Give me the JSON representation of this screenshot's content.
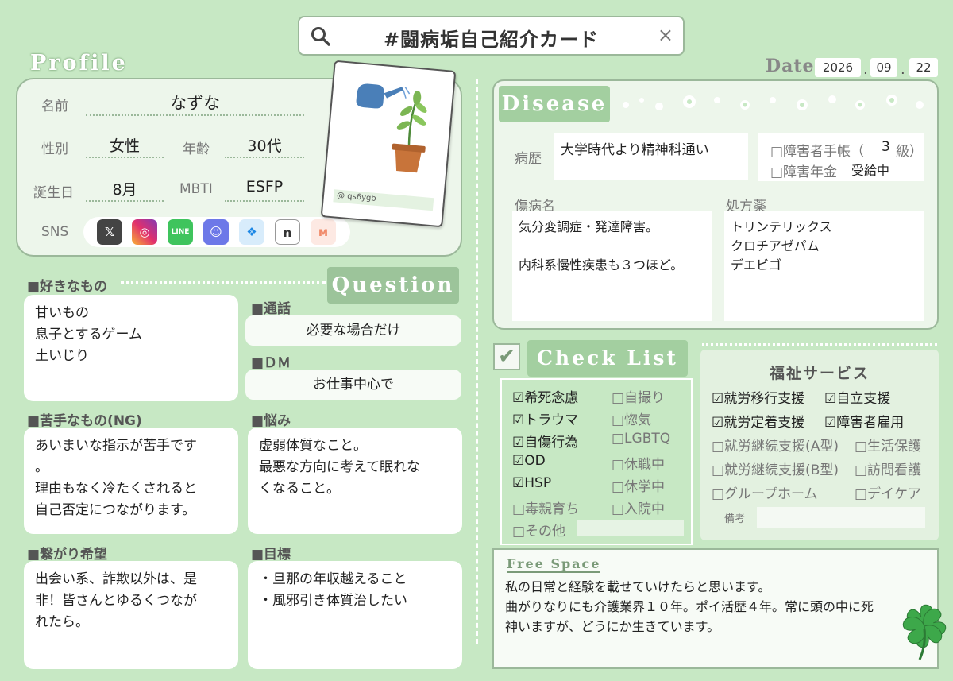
{
  "search": {
    "title": "#闘病垢自己紹介カード",
    "close": "×"
  },
  "profile": {
    "heading": "Profile",
    "name_label": "名前",
    "name": "なずな",
    "gender_label": "性別",
    "gender": "女性",
    "age_label": "年齢",
    "age": "30代",
    "birthday_label": "誕生日",
    "birthday": "8月",
    "mbti_label": "MBTI",
    "mbti": "ESFP",
    "sns_label": "SNS",
    "sns_icons": [
      "x-icon",
      "instagram-icon",
      "line-icon",
      "discord-icon",
      "bluesky-icon",
      "note-icon",
      "misskey-icon"
    ],
    "handle": "@ qs6ygb"
  },
  "date": {
    "label": "Date",
    "year": "2026",
    "month": "09",
    "day": "22",
    "sep": "."
  },
  "likes": {
    "title": "■好きなもの",
    "text": "甘いもの\n息子とするゲーム\n土いじり"
  },
  "question": {
    "title": "Question"
  },
  "call": {
    "title": "■通話",
    "value": "必要な場合だけ"
  },
  "dm": {
    "title": "■ＤＭ",
    "value": "お仕事中心で"
  },
  "dislikes": {
    "title": "■苦手なもの(NG)",
    "text": "あいまいな指示が苦手です\n。\n理由もなく冷たくされると\n自己否定につながります。"
  },
  "worries": {
    "title": "■悩み",
    "text": "虚弱体質なこと。\n最悪な方向に考えて眠れな\nくなること。"
  },
  "connect": {
    "title": "■繋がり希望",
    "text": "出会い系、詐欺以外は、是\n非！皆さんとゆるくつなが\nれたら。"
  },
  "goals": {
    "title": "■目標",
    "text": "・旦那の年収越えること\n・風邪引き体質治したい"
  },
  "disease": {
    "heading": "Disease",
    "history_label": "病歴",
    "history": "大学時代より精神科通い",
    "handbook": "□障害者手帳（",
    "grade": "3",
    "grade_suffix": "級）",
    "pension": "□障害年金",
    "pension_value": "受給中",
    "diagnosis_label": "傷病名",
    "diagnosis": "気分変調症・発達障害。\n\n内科系慢性疾患も３つほど。",
    "meds_label": "処方薬",
    "meds": "トリンテリックス\nクロチアゼパム\nデエビゴ"
  },
  "checklist": {
    "heading": "Check List",
    "left": [
      "☑希死念慮",
      "☑トラウマ",
      "☑自傷行為",
      "☑OD",
      "☑HSP",
      "□毒親育ち",
      "□その他"
    ],
    "right": [
      "□自撮り",
      "□惚気",
      "□LGBTQ",
      "□休職中",
      "□休学中",
      "□入院中"
    ]
  },
  "welfare": {
    "title": "福祉サービス",
    "rows": [
      [
        "☑就労移行支援",
        "☑自立支援"
      ],
      [
        "☑就労定着支援",
        "☑障害者雇用"
      ],
      [
        "□就労継続支援(A型)",
        "□生活保護"
      ],
      [
        "□就労継続支援(B型)",
        "□訪問看護"
      ],
      [
        "□グループホーム",
        "□デイケア"
      ]
    ],
    "notes_label": "備考"
  },
  "free": {
    "title": "Free Space",
    "text": "私の日常と経験を載せていけたらと思います。\n曲がりなりにも介護業界１０年。ポイ活歴４年。常に頭の中に死\n神いますが、どうにか生きています。"
  },
  "colors": {
    "bg": "#c7e8c4",
    "accent": "#a3cfa0",
    "border": "#9bb89a"
  }
}
